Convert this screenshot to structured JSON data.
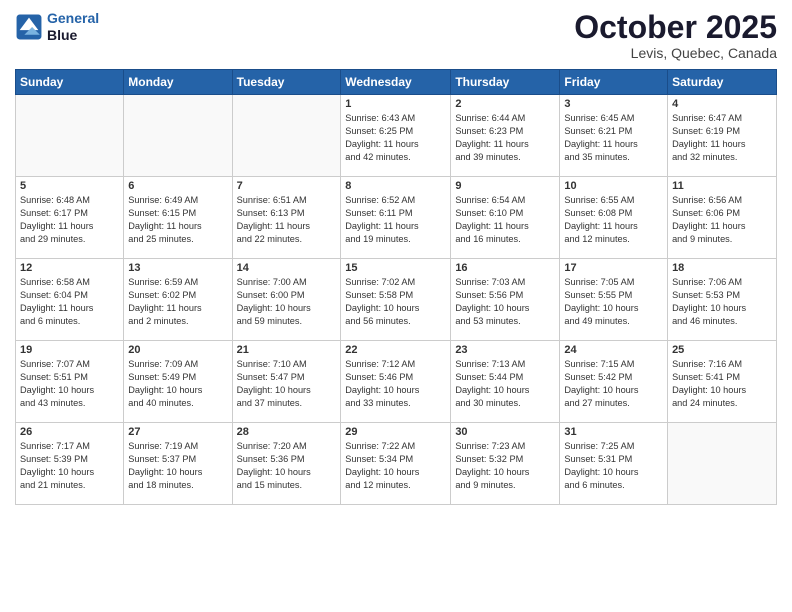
{
  "header": {
    "logo_line1": "General",
    "logo_line2": "Blue",
    "month": "October 2025",
    "location": "Levis, Quebec, Canada"
  },
  "weekdays": [
    "Sunday",
    "Monday",
    "Tuesday",
    "Wednesday",
    "Thursday",
    "Friday",
    "Saturday"
  ],
  "weeks": [
    [
      {
        "day": "",
        "info": ""
      },
      {
        "day": "",
        "info": ""
      },
      {
        "day": "",
        "info": ""
      },
      {
        "day": "1",
        "info": "Sunrise: 6:43 AM\nSunset: 6:25 PM\nDaylight: 11 hours\nand 42 minutes."
      },
      {
        "day": "2",
        "info": "Sunrise: 6:44 AM\nSunset: 6:23 PM\nDaylight: 11 hours\nand 39 minutes."
      },
      {
        "day": "3",
        "info": "Sunrise: 6:45 AM\nSunset: 6:21 PM\nDaylight: 11 hours\nand 35 minutes."
      },
      {
        "day": "4",
        "info": "Sunrise: 6:47 AM\nSunset: 6:19 PM\nDaylight: 11 hours\nand 32 minutes."
      }
    ],
    [
      {
        "day": "5",
        "info": "Sunrise: 6:48 AM\nSunset: 6:17 PM\nDaylight: 11 hours\nand 29 minutes."
      },
      {
        "day": "6",
        "info": "Sunrise: 6:49 AM\nSunset: 6:15 PM\nDaylight: 11 hours\nand 25 minutes."
      },
      {
        "day": "7",
        "info": "Sunrise: 6:51 AM\nSunset: 6:13 PM\nDaylight: 11 hours\nand 22 minutes."
      },
      {
        "day": "8",
        "info": "Sunrise: 6:52 AM\nSunset: 6:11 PM\nDaylight: 11 hours\nand 19 minutes."
      },
      {
        "day": "9",
        "info": "Sunrise: 6:54 AM\nSunset: 6:10 PM\nDaylight: 11 hours\nand 16 minutes."
      },
      {
        "day": "10",
        "info": "Sunrise: 6:55 AM\nSunset: 6:08 PM\nDaylight: 11 hours\nand 12 minutes."
      },
      {
        "day": "11",
        "info": "Sunrise: 6:56 AM\nSunset: 6:06 PM\nDaylight: 11 hours\nand 9 minutes."
      }
    ],
    [
      {
        "day": "12",
        "info": "Sunrise: 6:58 AM\nSunset: 6:04 PM\nDaylight: 11 hours\nand 6 minutes."
      },
      {
        "day": "13",
        "info": "Sunrise: 6:59 AM\nSunset: 6:02 PM\nDaylight: 11 hours\nand 2 minutes."
      },
      {
        "day": "14",
        "info": "Sunrise: 7:00 AM\nSunset: 6:00 PM\nDaylight: 10 hours\nand 59 minutes."
      },
      {
        "day": "15",
        "info": "Sunrise: 7:02 AM\nSunset: 5:58 PM\nDaylight: 10 hours\nand 56 minutes."
      },
      {
        "day": "16",
        "info": "Sunrise: 7:03 AM\nSunset: 5:56 PM\nDaylight: 10 hours\nand 53 minutes."
      },
      {
        "day": "17",
        "info": "Sunrise: 7:05 AM\nSunset: 5:55 PM\nDaylight: 10 hours\nand 49 minutes."
      },
      {
        "day": "18",
        "info": "Sunrise: 7:06 AM\nSunset: 5:53 PM\nDaylight: 10 hours\nand 46 minutes."
      }
    ],
    [
      {
        "day": "19",
        "info": "Sunrise: 7:07 AM\nSunset: 5:51 PM\nDaylight: 10 hours\nand 43 minutes."
      },
      {
        "day": "20",
        "info": "Sunrise: 7:09 AM\nSunset: 5:49 PM\nDaylight: 10 hours\nand 40 minutes."
      },
      {
        "day": "21",
        "info": "Sunrise: 7:10 AM\nSunset: 5:47 PM\nDaylight: 10 hours\nand 37 minutes."
      },
      {
        "day": "22",
        "info": "Sunrise: 7:12 AM\nSunset: 5:46 PM\nDaylight: 10 hours\nand 33 minutes."
      },
      {
        "day": "23",
        "info": "Sunrise: 7:13 AM\nSunset: 5:44 PM\nDaylight: 10 hours\nand 30 minutes."
      },
      {
        "day": "24",
        "info": "Sunrise: 7:15 AM\nSunset: 5:42 PM\nDaylight: 10 hours\nand 27 minutes."
      },
      {
        "day": "25",
        "info": "Sunrise: 7:16 AM\nSunset: 5:41 PM\nDaylight: 10 hours\nand 24 minutes."
      }
    ],
    [
      {
        "day": "26",
        "info": "Sunrise: 7:17 AM\nSunset: 5:39 PM\nDaylight: 10 hours\nand 21 minutes."
      },
      {
        "day": "27",
        "info": "Sunrise: 7:19 AM\nSunset: 5:37 PM\nDaylight: 10 hours\nand 18 minutes."
      },
      {
        "day": "28",
        "info": "Sunrise: 7:20 AM\nSunset: 5:36 PM\nDaylight: 10 hours\nand 15 minutes."
      },
      {
        "day": "29",
        "info": "Sunrise: 7:22 AM\nSunset: 5:34 PM\nDaylight: 10 hours\nand 12 minutes."
      },
      {
        "day": "30",
        "info": "Sunrise: 7:23 AM\nSunset: 5:32 PM\nDaylight: 10 hours\nand 9 minutes."
      },
      {
        "day": "31",
        "info": "Sunrise: 7:25 AM\nSunset: 5:31 PM\nDaylight: 10 hours\nand 6 minutes."
      },
      {
        "day": "",
        "info": ""
      }
    ]
  ]
}
